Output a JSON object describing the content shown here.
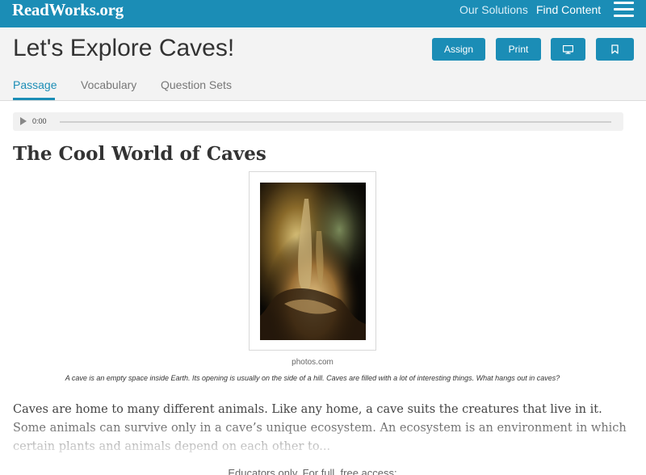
{
  "nav": {
    "logo": "ReadWorks.org",
    "links": [
      "Our Solutions",
      "Find Content"
    ],
    "menu_icon": "hamburger-menu-icon"
  },
  "header": {
    "title": "Let's Explore Caves!",
    "buttons": {
      "assign": "Assign",
      "print": "Print",
      "present_icon": "monitor-icon",
      "bookmark_icon": "bookmark-icon"
    },
    "tabs": [
      {
        "label": "Passage",
        "active": true
      },
      {
        "label": "Vocabulary",
        "active": false
      },
      {
        "label": "Question Sets",
        "active": false
      }
    ]
  },
  "audio": {
    "time": "0:00",
    "play_icon": "play-icon"
  },
  "article": {
    "title": "The Cool World of Caves",
    "image_credit": "photos.com",
    "caption": "A cave is an empty space inside Earth. Its opening is usually on the side of a hill. Caves are filled with a lot of interesting things. What hangs out in caves?",
    "body": "Caves are home to many different animals. Like any home, a cave suits the creatures that live in it. Some animals can survive only in a cave’s unique ecosystem. An ecosystem is an environment in which certain plants and animals depend on each other to..."
  },
  "cta": {
    "text": "Educators only. For full, free access:"
  },
  "colors": {
    "brand": "#1b8db6",
    "header_bg": "#f3f3f3"
  }
}
